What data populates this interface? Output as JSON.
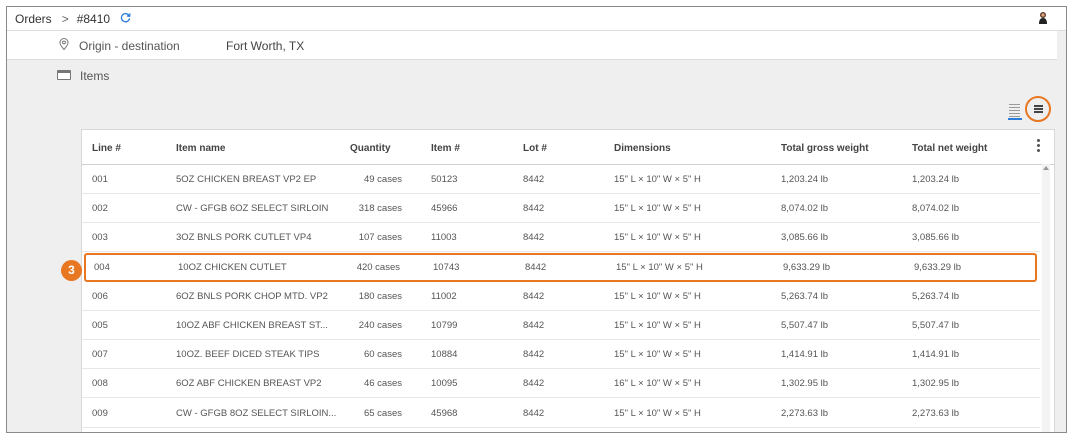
{
  "breadcrumb": {
    "root": "Orders",
    "separator": ">",
    "order_id": "#8410"
  },
  "icons": {
    "refresh": "refresh-icon",
    "avatar": "avatar",
    "location": "location-pin-icon",
    "items": "box-icon",
    "list_view": "list-view-icon",
    "compact_view": "compact-view-icon",
    "more": "more-vertical-icon"
  },
  "origin": {
    "label": "Origin - destination",
    "value": "Fort Worth, TX"
  },
  "items": {
    "label": "Items"
  },
  "step_badge": "3",
  "colors": {
    "accent": "#e87722",
    "link": "#2b7bd8"
  },
  "table": {
    "headers": [
      "Line #",
      "Item name",
      "Quantity",
      "Item #",
      "Lot #",
      "Dimensions",
      "Total gross weight",
      "Total net weight"
    ],
    "rows": [
      [
        "001",
        "5OZ CHICKEN BREAST VP2 EP",
        "49 cases",
        "50123",
        "8442",
        "15\" L × 10\" W × 5\" H",
        "1,203.24 lb",
        "1,203.24 lb"
      ],
      [
        "002",
        "CW - GFGB 6OZ SELECT SIRLOIN",
        "318 cases",
        "45966",
        "8442",
        "15\" L × 10\" W × 5\" H",
        "8,074.02 lb",
        "8,074.02 lb"
      ],
      [
        "003",
        "3OZ BNLS PORK CUTLET VP4",
        "107 cases",
        "11003",
        "8442",
        "15\" L × 10\" W × 5\" H",
        "3,085.66 lb",
        "3,085.66 lb"
      ],
      [
        "004",
        "10OZ CHICKEN CUTLET",
        "420 cases",
        "10743",
        "8442",
        "15\" L × 10\" W × 5\" H",
        "9,633.29 lb",
        "9,633.29 lb"
      ],
      [
        "006",
        "6OZ BNLS PORK CHOP MTD. VP2",
        "180 cases",
        "11002",
        "8442",
        "15\" L × 10\" W × 5\" H",
        "5,263.74 lb",
        "5,263.74 lb"
      ],
      [
        "005",
        "10OZ ABF CHICKEN BREAST ST...",
        "240 cases",
        "10799",
        "8442",
        "15\" L × 10\" W × 5\" H",
        "5,507.47 lb",
        "5,507.47 lb"
      ],
      [
        "007",
        "10OZ. BEEF DICED STEAK TIPS",
        "60 cases",
        "10884",
        "8442",
        "15\" L × 10\" W × 5\" H",
        "1,414.91 lb",
        "1,414.91 lb"
      ],
      [
        "008",
        "6OZ ABF CHICKEN BREAST VP2",
        "46 cases",
        "10095",
        "8442",
        "16\" L × 10\" W × 5\" H",
        "1,302.95 lb",
        "1,302.95 lb"
      ],
      [
        "009",
        "CW - GFGB 8OZ SELECT SIRLOIN...",
        "65 cases",
        "45968",
        "8442",
        "15\" L × 10\" W × 5\" H",
        "2,273.63 lb",
        "2,273.63 lb"
      ]
    ]
  }
}
